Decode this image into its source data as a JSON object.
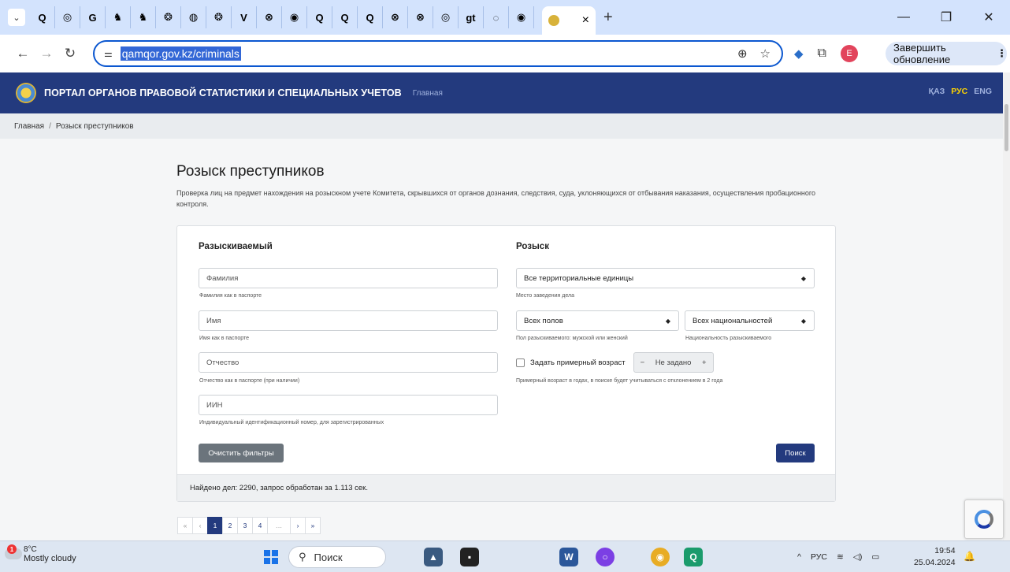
{
  "browser": {
    "mini_tabs": [
      "Q",
      "◎",
      "G",
      "♞",
      "♞",
      "❂",
      "◍",
      "❂",
      "V",
      "⊗",
      "◉",
      "Q",
      "Q",
      "Q",
      "⊗",
      "⊗",
      "◎",
      "gt",
      "◌",
      "◉"
    ],
    "url": "qamqor.gov.kz/criminals",
    "update_label": "Завершить обновление",
    "profile_letter": "E",
    "close_tab": "×",
    "new_tab": "+"
  },
  "header": {
    "title": "ПОРТАЛ ОРГАНОВ ПРАВОВОЙ СТАТИСТИКИ И СПЕЦИАЛЬНЫХ УЧЕТОВ",
    "home": "Главная",
    "langs": [
      "ҚАЗ",
      "РУС",
      "ENG"
    ],
    "active_lang": "РУС"
  },
  "breadcrumb": {
    "home": "Главная",
    "separator": "/",
    "current": "Розыск преступников"
  },
  "page": {
    "title": "Розыск преступников",
    "description": "Проверка лиц на предмет нахождения на розыскном учете Комитета, скрывшихся от органов дознания, следствия, суда, уклоняющихся от отбывания наказания, осуществления пробационного контроля."
  },
  "form": {
    "left_title": "Разыскиваемый",
    "right_title": "Розыск",
    "surname_ph": "Фамилия",
    "surname_hint": "Фамилия как в паспорте",
    "name_ph": "Имя",
    "name_hint": "Имя как в паспорте",
    "patronymic_ph": "Отчество",
    "patronymic_hint": "Отчество как в паспорте (при наличии)",
    "iin_ph": "ИИН",
    "iin_hint": "Индивидуальный идентификационный номер, для зарегистрированных",
    "territory_value": "Все территориальные единицы",
    "territory_hint": "Место заведения дела",
    "gender_value": "Всех полов",
    "gender_hint": "Пол разыскиваемого: мужской или женский",
    "nationality_value": "Всех национальностей",
    "nationality_hint": "Национальность разыскиваемого",
    "age_label": "Задать примерный возраст",
    "age_value": "Не задано",
    "age_minus": "−",
    "age_plus": "+",
    "age_hint": "Примерный возраст в годах, в поиске будет учитываться с отклонением в 2 года",
    "clear_label": "Очистить фильтры",
    "search_label": "Поиск",
    "result_text": "Найдено дел: 2290, запрос обработан за 1.113 сек."
  },
  "pagination": {
    "first": "«",
    "prev": "‹",
    "pages": [
      "1",
      "2",
      "3",
      "4"
    ],
    "ellipsis": "…",
    "next": "›",
    "last": "»",
    "active_page": "1"
  },
  "taskbar": {
    "temp": "8°C",
    "condition": "Mostly cloudy",
    "weather_badge": "1",
    "search_label": "Поиск",
    "lang": "РУС",
    "time": "19:54",
    "date": "25.04.2024"
  }
}
